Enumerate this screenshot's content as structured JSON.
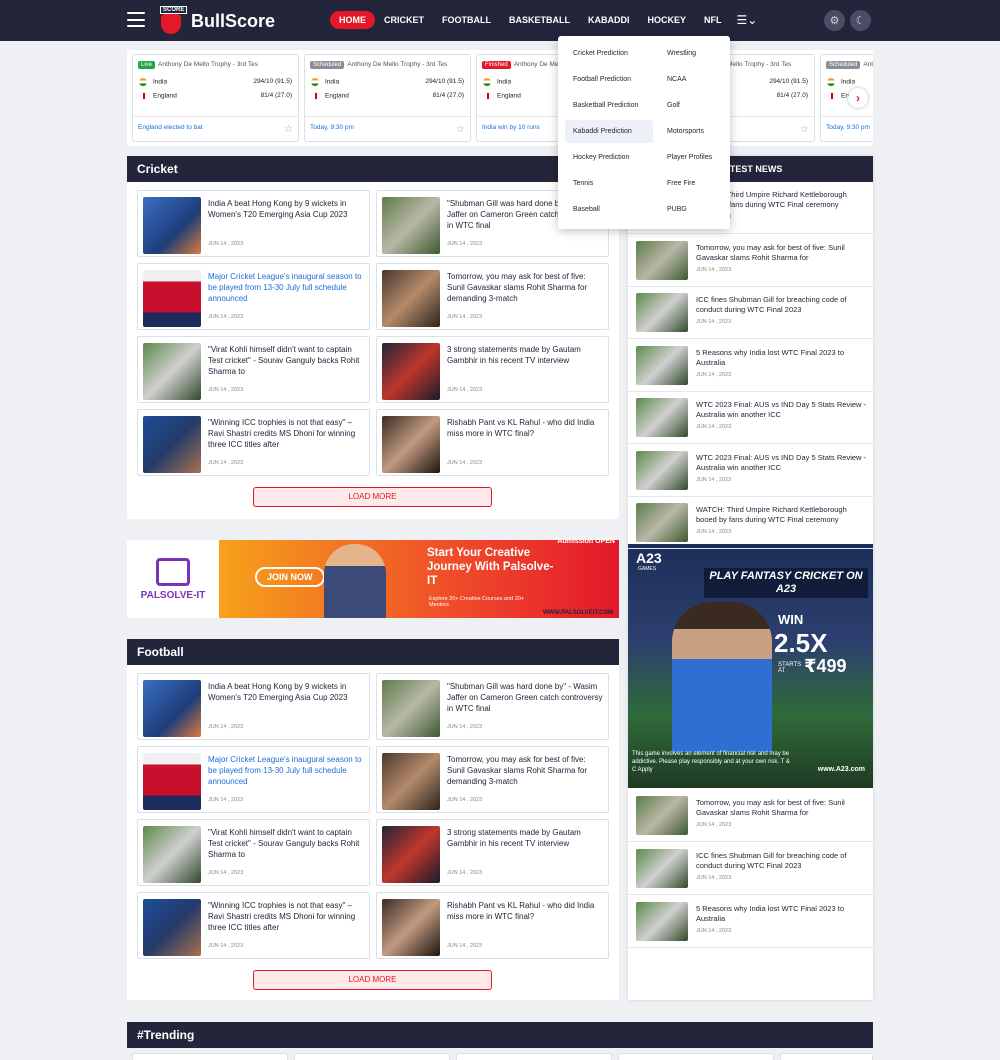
{
  "header": {
    "logo_text": "BullScore",
    "logo_tag": "SCORE",
    "menu": [
      "HOME",
      "CRICKET",
      "FOOTBALL",
      "BASKETBALL",
      "KABADDI",
      "HOCKEY",
      "NFL"
    ],
    "active_menu": "HOME"
  },
  "dropdown": {
    "left": [
      "Cricket Prediction",
      "Football Prediction",
      "Basketball Prediction",
      "Kabaddi Prediction",
      "Hockey Prediction",
      "Tennis",
      "Baseball"
    ],
    "right": [
      "Wrestling",
      "NCAA",
      "Golf",
      "Motorsports",
      "Player Profiles",
      "Free Fire",
      "PUBG"
    ],
    "highlighted": "Kabaddi Prediction"
  },
  "scores": [
    {
      "status": "Live",
      "title": "Anthony De Mello Trophy - 3rd Tes",
      "team1": "India",
      "score1": "294/10 (91.5)",
      "team2": "England",
      "score2": "81/4 (27.0)",
      "footer": "England elected to bat"
    },
    {
      "status": "Scheduled",
      "title": "Anthony De Mello Trophy - 3rd Tes",
      "team1": "India",
      "score1": "294/10 (91.5)",
      "team2": "England",
      "score2": "81/4 (27.0)",
      "footer": "Today, 9:30 pm"
    },
    {
      "status": "Finished",
      "title": "Anthony De Mello Trophy - 3rd Tes",
      "team1": "India",
      "score1": "294/10 (91.5)",
      "team2": "England",
      "score2": "81/4 (27.0)",
      "footer": "India win by 10 runs"
    },
    {
      "status": "Scheduled",
      "title": "Anthony De Mello Trophy - 3rd Tes",
      "team1": "India",
      "score1": "294/10 (91.5)",
      "team2": "England",
      "score2": "81/4 (27.0)",
      "footer": "Today, 9:30 pm"
    },
    {
      "status": "Scheduled",
      "title": "Anthony De Mello Trophy - 3rd Tes",
      "team1": "India",
      "score1": "294/10 (91.5)",
      "team2": "England",
      "score2": "81/4 (27.0)",
      "footer": "Today, 9:30 pm"
    }
  ],
  "cricket": {
    "title": "Cricket",
    "load_more": "LOAD MORE",
    "articles": [
      {
        "title": "India A beat Hong Kong by 9 wickets in Women's T20 Emerging Asia Cup 2023",
        "date": "JUN 14 , 2023",
        "highlight": false,
        "thumb": "th1"
      },
      {
        "title": "\"Shubman Gill was hard done by\" - Wasim Jaffer on Cameron Green catch controversy in WTC final",
        "date": "JUN 14 , 2023",
        "highlight": false,
        "thumb": "th2"
      },
      {
        "title": "Major Cricket League's inaugural season to be played from 13-30 July full schedule announced",
        "date": "JUN 14 , 2023",
        "highlight": true,
        "thumb": "th3"
      },
      {
        "title": "Tomorrow, you may ask for best of five: Sunil Gavaskar slams Rohit Sharma for demanding 3-match",
        "date": "JUN 14 , 2023",
        "highlight": false,
        "thumb": "th4"
      },
      {
        "title": "\"Virat Kohli himself didn't want to captain Test cricket\" - Sourav Ganguly backs Rohit Sharma to",
        "date": "JUN 14 , 2023",
        "highlight": false,
        "thumb": "th5"
      },
      {
        "title": "3 strong statements made by Gautam Gambhir in his recent TV interview",
        "date": "JUN 14 , 2023",
        "highlight": false,
        "thumb": "th6"
      },
      {
        "title": "\"Winning ICC trophies is not that easy\" – Ravi Shastri credits MS Dhoni for winning three ICC titles after",
        "date": "JUN 14 , 2023",
        "highlight": false,
        "thumb": "th7"
      },
      {
        "title": "Rishabh Pant vs KL Rahul - who did India miss more in WTC final?",
        "date": "JUN 14 , 2023",
        "highlight": false,
        "thumb": "th8"
      }
    ]
  },
  "football": {
    "title": "Football",
    "load_more": "LOAD MORE",
    "articles": [
      {
        "title": "India A beat Hong Kong by 9 wickets in Women's T20 Emerging Asia Cup 2023",
        "date": "JUN 14 , 2023",
        "highlight": false,
        "thumb": "th1"
      },
      {
        "title": "\"Shubman Gill was hard done by\" - Wasim Jaffer on Cameron Green catch controversy in WTC final",
        "date": "JUN 14 , 2023",
        "highlight": false,
        "thumb": "th2"
      },
      {
        "title": "Major Cricket League's inaugural season to be played from 13-30 July full schedule announced",
        "date": "JUN 14 , 2023",
        "highlight": true,
        "thumb": "th3"
      },
      {
        "title": "Tomorrow, you may ask for best of five: Sunil Gavaskar slams Rohit Sharma for demanding 3-match",
        "date": "JUN 14 , 2023",
        "highlight": false,
        "thumb": "th4"
      },
      {
        "title": "\"Virat Kohli himself didn't want to captain Test cricket\" - Sourav Ganguly backs Rohit Sharma to",
        "date": "JUN 14 , 2023",
        "highlight": false,
        "thumb": "th5"
      },
      {
        "title": "3 strong statements made by Gautam Gambhir in his recent TV interview",
        "date": "JUN 14 , 2023",
        "highlight": false,
        "thumb": "th6"
      },
      {
        "title": "\"Winning ICC trophies is not that easy\" – Ravi Shastri credits MS Dhoni for winning three ICC titles after",
        "date": "JUN 14 , 2023",
        "highlight": false,
        "thumb": "th7"
      },
      {
        "title": "Rishabh Pant vs KL Rahul - who did India miss more in WTC final?",
        "date": "JUN 14 , 2023",
        "highlight": false,
        "thumb": "th8"
      }
    ]
  },
  "ad_banner": {
    "brand": "PALSOLVE-IT",
    "join": "JOIN NOW",
    "headline": "Start Your Creative Journey With Palsolve- IT",
    "sub": "Explore 20+ Creative Courses and 20+ Mentors",
    "url": "WWW.PALSOLVEIT.COM",
    "admission": "Admission OPEN"
  },
  "latest_news": {
    "title": "LATEST NEWS",
    "items_top": [
      {
        "title": "WATCH: Third Umpire Richard Kettleborough booed by fans during WTC Final ceremony",
        "date": "JUN 14 , 2023",
        "thumb": "th2"
      },
      {
        "title": "Tomorrow, you may ask for best of five: Sunil Gavaskar slams Rohit Sharma for",
        "date": "JUN 14 , 2023",
        "thumb": "th2"
      },
      {
        "title": "ICC fines Shubman Gill for breaching code of conduct during WTC Final 2023",
        "date": "JUN 14 , 2023",
        "thumb": "th5"
      },
      {
        "title": "5 Reasons why India lost WTC Final 2023 to Australia",
        "date": "JUN 14 , 2023",
        "thumb": "th5"
      },
      {
        "title": "WTC 2023 Final: AUS vs IND Day 5 Stats Review - Australia win another ICC",
        "date": "JUN 14 , 2023",
        "thumb": "th5"
      },
      {
        "title": "WTC 2023 Final: AUS vs IND Day 5 Stats Review - Australia win another ICC",
        "date": "JUN 14 , 2023",
        "thumb": "th5"
      },
      {
        "title": "WATCH: Third Umpire Richard Kettleborough booed by fans during WTC Final ceremony",
        "date": "JUN 14 , 2023",
        "thumb": "th2"
      }
    ],
    "items_bottom": [
      {
        "title": "Tomorrow, you may ask for best of five: Sunil Gavaskar slams Rohit Sharma for",
        "date": "JUN 14 , 2023",
        "thumb": "th2"
      },
      {
        "title": "ICC fines Shubman Gill for breaching code of conduct during WTC Final 2023",
        "date": "JUN 14 , 2023",
        "thumb": "th5"
      },
      {
        "title": "5 Reasons why India lost WTC Final 2023 to Australia",
        "date": "JUN 14 , 2023",
        "thumb": "th5"
      }
    ]
  },
  "fantasy_ad": {
    "brand": "A23",
    "brand_sub": "GAMES",
    "headline": "PLAY FANTASY CRICKET ON A23",
    "win": "WIN",
    "multiplier": "2.5X",
    "starts_at": "STARTS AT",
    "amount": "₹499",
    "disclaimer": "This game involves an element of financial risk and may be addictive. Please play responsibly and at your own risk. T & C Apply",
    "site": "www.A23.com"
  },
  "trending": {
    "title": "#Trending"
  }
}
